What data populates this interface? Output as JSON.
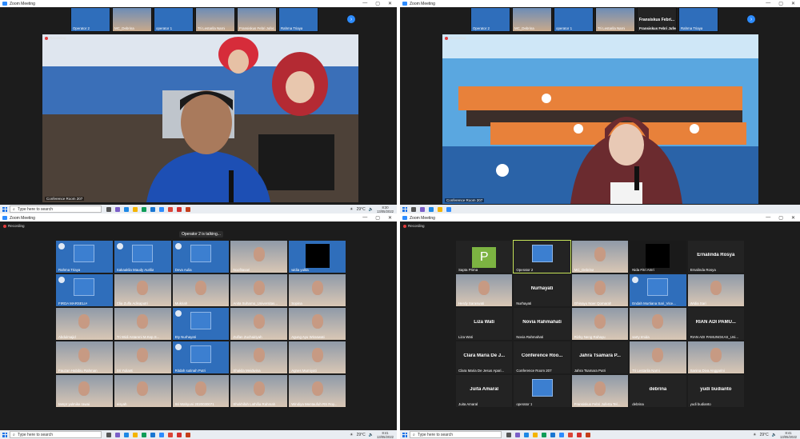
{
  "window_title": "Zoom Meeting",
  "recording_label": "Recording",
  "q1": {
    "strip": [
      "Operator 2",
      "MC_Debrina",
      "operator 1",
      "Tri Lestarila Narni",
      "Fransiskus Febri Jufer...",
      "Rahma Triaya"
    ],
    "room_label": "Conference Room 207"
  },
  "q2": {
    "strip": [
      "Operator 2",
      "MC_Debrina",
      "operator 1",
      "Tri Lestarila Narni",
      "Fransiskus Febri Jufer...",
      "Rahma Triaya"
    ],
    "strip_text": "Fransiskus Febri...",
    "room_label": "Conference Room 207"
  },
  "q3": {
    "talking": "Operator 2 is talking...",
    "cells": [
      "Rahma Triaya",
      "Sakaaklia Maudy Aurilia",
      "Deva Aulia",
      "Noofitasari",
      "widia yulita",
      "FIRDA MARSELIA",
      "Clia Zulfa Adisaputri",
      "Mukriah",
      "Anita Suharno_Universitas...",
      "Sopina",
      "Abdulmajid",
      "Tri Widi Astareni M.Kep.S...",
      "Ety Nurhayati",
      "Zulfan Zuchairiyah",
      "Agung Ayu Wiraswati",
      "Fauzan Habibiu Rahman",
      "Sri Yulianti",
      "Ritdah sutinah Putri",
      "Shakila Meidwina",
      "Agnes Murniyati",
      "tampr yulmike rawai",
      "eisyah",
      "Sri Wahyuni 2020030071",
      "Shokhifah Lathifia Rahmah",
      "Windiya Mentaufuh RS Roy..."
    ]
  },
  "q4": {
    "cells": [
      {
        "name": "Sapta Prima",
        "big": "",
        "avatar": "P"
      },
      {
        "name": "Operator 2",
        "big": ""
      },
      {
        "name": "MC_Debrina",
        "big": ""
      },
      {
        "name": "Nida Fitri Amri",
        "big": ""
      },
      {
        "name": "Ernalinda Rosya",
        "big": "Ernalinda Rosya"
      },
      {
        "name": "Herdy Saraswati",
        "big": ""
      },
      {
        "name": "Nurhayati",
        "big": "Nurhayati"
      },
      {
        "name": "Ghinayu Noer Qomarah",
        "big": ""
      },
      {
        "name": "Endah Murtiana Sari_Vice...",
        "big": ""
      },
      {
        "name": "Widia Sari",
        "big": ""
      },
      {
        "name": "Liza Wati",
        "big": "Liza Wati"
      },
      {
        "name": "Novia Rahmahati",
        "big": "Novia Rahmahati"
      },
      {
        "name": "Rizky Neng Rahayu",
        "big": ""
      },
      {
        "name": "sarty Imida",
        "big": ""
      },
      {
        "name": "RIAN ADI PAMUNGKAS_Uni...",
        "big": "RIAN ADI PAMU..."
      },
      {
        "name": "Clara Maria De Jesus Apari...",
        "big": "Clara Maria De J..."
      },
      {
        "name": "Conference Room 207",
        "big": "Conference Roo..."
      },
      {
        "name": "Jahra Tsamara Putri",
        "big": "Jahra Tsamara P..."
      },
      {
        "name": "Tri Lestarila Narni",
        "big": ""
      },
      {
        "name": "Sanina Diva Anggarini",
        "big": ""
      },
      {
        "name": "Juita Amaral",
        "big": "Juita Amaral"
      },
      {
        "name": "operator 1",
        "big": ""
      },
      {
        "name": "Fransiskus Febri Juferta Tel...",
        "big": ""
      },
      {
        "name": "debrina",
        "big": "debrina"
      },
      {
        "name": "yudi budianto",
        "big": "yudi budianto"
      }
    ]
  },
  "taskbar": {
    "search_placeholder": "Type here to search",
    "weather": "29°C",
    "time_top": "8:30",
    "date_top": "13/05/2022",
    "time_bottom": "8:41",
    "date_bottom": "13/05/2022"
  }
}
